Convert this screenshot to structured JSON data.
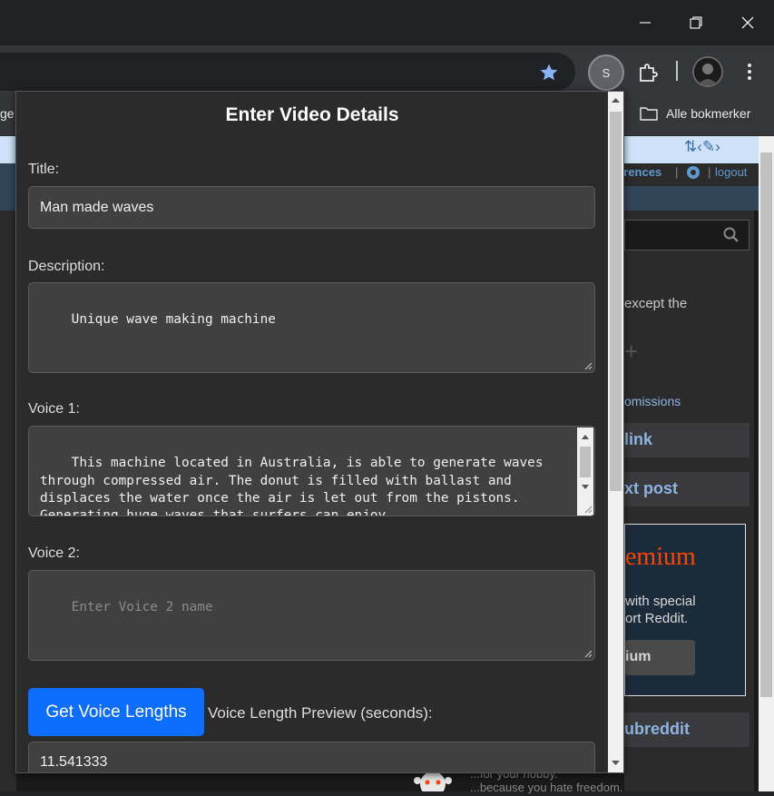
{
  "browser": {
    "window_controls": {
      "minimize": "—",
      "maximize": "❐",
      "close": "✕"
    },
    "profile_initial": "S",
    "bookmarks_bar": {
      "left_partial": "ge",
      "folder_label": "Alle bokmerker"
    }
  },
  "background_page": {
    "userbar": {
      "preferences_partial": "erences",
      "separator": "|",
      "logout": "logout"
    },
    "sidebar_text": {
      "except": "except the",
      "plus": "+",
      "submissions": "omissions",
      "link": "link",
      "text_post": "xt post",
      "premium": "emium",
      "special": "with special",
      "support": "ort Reddit.",
      "premium_btn": "ium",
      "subreddit": "ubreddit",
      "hobby": "...for your hobby.",
      "freedom": "...because you hate freedom."
    }
  },
  "popup": {
    "heading": "Enter Video Details",
    "title_label": "Title:",
    "title_value": "Man made waves",
    "description_label": "Description:",
    "description_value": "Unique wave making machine",
    "voice1_label": "Voice 1:",
    "voice1_value": "This machine located in Australia, is able to generate waves through compressed air. The donut is filled with ballast and displaces the water once the air is let out from the pistons. Generating huge waves that surfers can enjoy.",
    "voice2_label": "Voice 2:",
    "voice2_placeholder": "Enter Voice 2 name",
    "get_lengths_button": "Get Voice Lengths",
    "preview_label": "Voice Length Preview (seconds):",
    "preview_value": "11.541333"
  },
  "colors": {
    "primary_button": "#0d6efd",
    "popup_bg": "#2b2b2b",
    "field_bg": "#404040"
  }
}
